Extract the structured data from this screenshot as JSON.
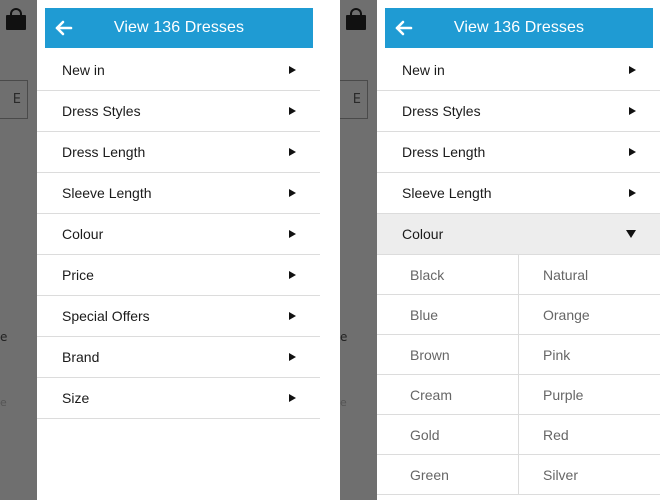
{
  "header": {
    "title_prefix": "View ",
    "count": "136",
    "title_suffix": " Dresses"
  },
  "accent_color": "#1f9bd3",
  "background_fragments": {
    "button_text": "E",
    "text_1": "e",
    "text_2": "e"
  },
  "left_menu": [
    {
      "label": "New in"
    },
    {
      "label": "Dress Styles"
    },
    {
      "label": "Dress Length"
    },
    {
      "label": "Sleeve Length"
    },
    {
      "label": "Colour"
    },
    {
      "label": "Price"
    },
    {
      "label": "Special Offers"
    },
    {
      "label": "Brand"
    },
    {
      "label": "Size"
    }
  ],
  "right_menu": [
    {
      "label": "New in"
    },
    {
      "label": "Dress Styles"
    },
    {
      "label": "Dress Length"
    },
    {
      "label": "Sleeve Length"
    },
    {
      "label": "Colour",
      "expanded": true
    }
  ],
  "colours": [
    "Black",
    "Natural",
    "Blue",
    "Orange",
    "Brown",
    "Pink",
    "Cream",
    "Purple",
    "Gold",
    "Red",
    "Green",
    "Silver"
  ],
  "icons": {
    "back": "back-arrow-icon",
    "collapsed": "triangle-right-icon",
    "expanded": "triangle-down-icon",
    "bag": "shopping-bag-icon"
  }
}
